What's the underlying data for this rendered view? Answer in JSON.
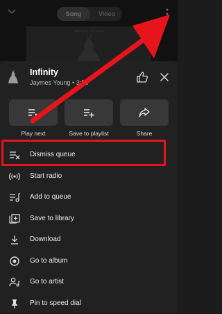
{
  "top": {
    "tabs": {
      "song": "Song",
      "video": "Video"
    },
    "album_caption": "JAYMES YOUNG"
  },
  "song": {
    "title": "Infinity",
    "subtitle": "Jaymes Young • 3:58"
  },
  "actions": [
    {
      "label": "Play next",
      "icon": "play-next-icon"
    },
    {
      "label": "Save to playlist",
      "icon": "playlist-add-icon"
    },
    {
      "label": "Share",
      "icon": "share-icon"
    }
  ],
  "menu": [
    {
      "label": "Dismiss queue",
      "icon": "dismiss-queue-icon"
    },
    {
      "label": "Start radio",
      "icon": "radio-icon"
    },
    {
      "label": "Add to queue",
      "icon": "add-to-queue-icon"
    },
    {
      "label": "Save to library",
      "icon": "library-add-icon"
    },
    {
      "label": "Download",
      "icon": "download-icon"
    },
    {
      "label": "Go to album",
      "icon": "album-icon"
    },
    {
      "label": "Go to artist",
      "icon": "artist-icon"
    },
    {
      "label": "Pin to speed dial",
      "icon": "pin-icon"
    }
  ],
  "colors": {
    "annotation": "#e8141c",
    "sheet": "#212121",
    "action_bg": "#383838"
  }
}
